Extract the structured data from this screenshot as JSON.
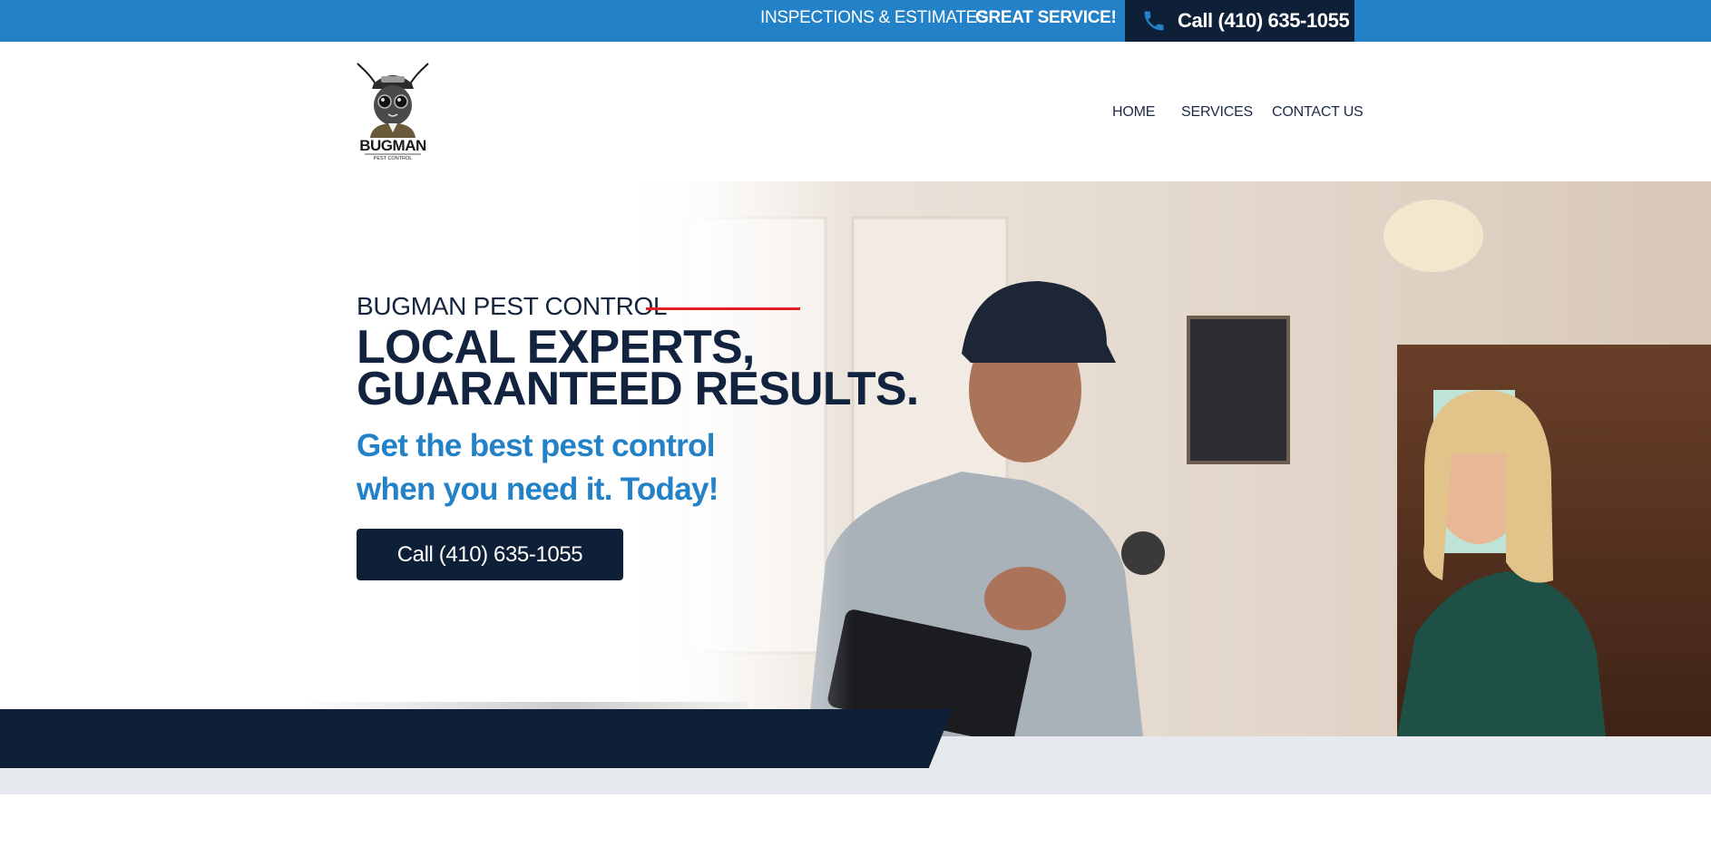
{
  "topbar": {
    "message_1": "INSPECTIONS & ESTIMATES",
    "message_2": "GREAT SERVICE!",
    "call_label": "Call (410) 635-1055",
    "phone_icon": "phone-icon"
  },
  "header": {
    "logo_text": "BUGMAN",
    "logo_subtext": "PEST CONTROL",
    "nav": [
      {
        "label": "HOME"
      },
      {
        "label": "SERVICES"
      },
      {
        "label": "CONTACT US"
      }
    ]
  },
  "hero": {
    "eyebrow": "BUGMAN PEST CONTROL",
    "headline_line1": "LOCAL EXPERTS,",
    "headline_line2": "GUARANTEED RESULTS.",
    "subhead_line1": "Get the best pest control",
    "subhead_line2": "when you need it. Today!",
    "cta_label": "Call (410) 635-1055"
  },
  "colors": {
    "brand_blue": "#2381c7",
    "navy": "#0e1f38",
    "accent_red": "#e31e24",
    "band_gray": "#e6e9ed"
  }
}
